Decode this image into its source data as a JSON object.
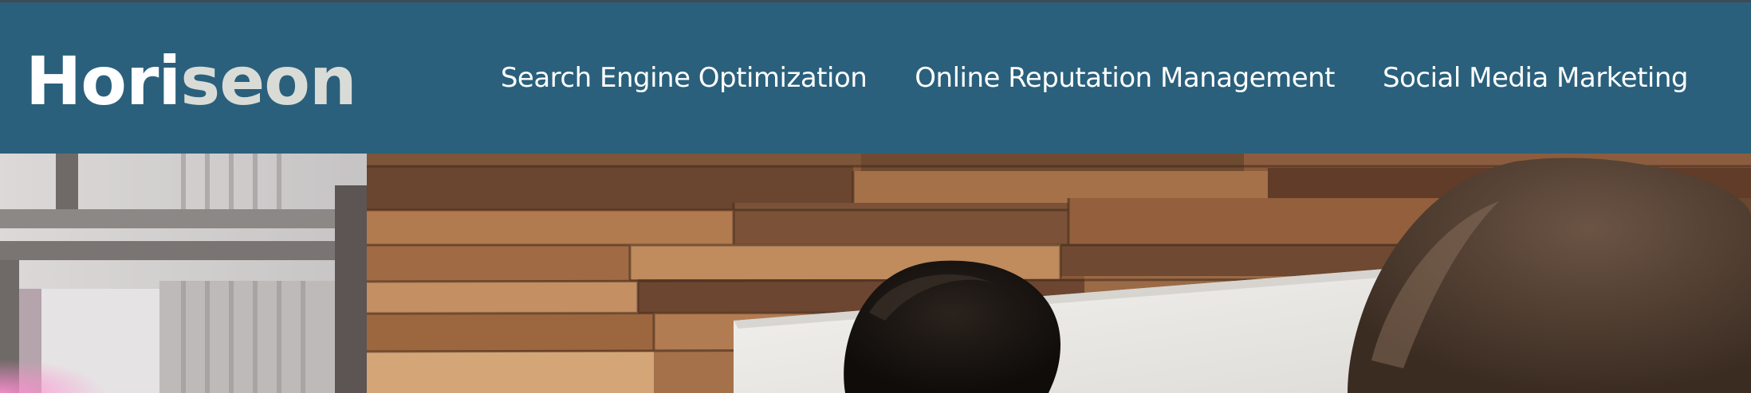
{
  "header": {
    "logo": {
      "primary": "Hori",
      "accent": "seon"
    },
    "nav": [
      {
        "label": "Search Engine Optimization"
      },
      {
        "label": "Online Reputation Management"
      },
      {
        "label": "Social Media Marketing"
      }
    ]
  },
  "hero": {
    "image_description": "office-photo"
  },
  "colors": {
    "header_bg": "#2a607c",
    "logo_accent": "#d9dcd6",
    "nav_text": "#ffffff"
  }
}
